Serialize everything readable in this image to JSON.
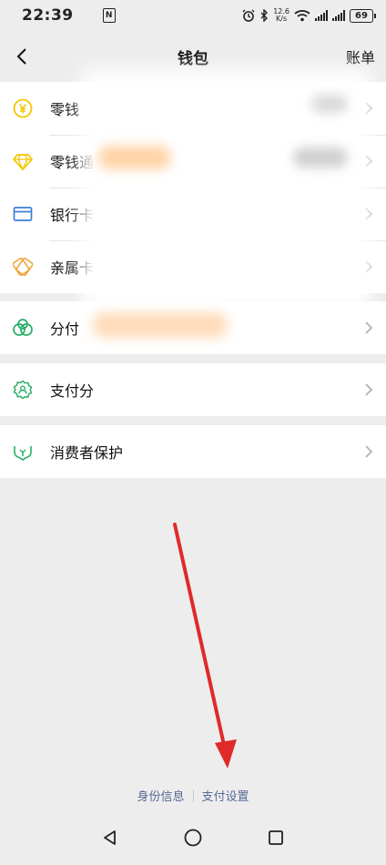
{
  "status_bar": {
    "time": "22:39",
    "nfc": "N",
    "net_speed_value": "12.6",
    "net_speed_unit": "K/s",
    "battery": "69"
  },
  "nav": {
    "title": "钱包",
    "right_link": "账单"
  },
  "groups": [
    {
      "items": [
        {
          "label": "零钱",
          "icon": "yuan-coin-icon",
          "color": "#f2c600"
        },
        {
          "label": "零钱通",
          "icon": "diamond-icon",
          "color": "#f2c600"
        },
        {
          "label": "银行卡",
          "icon": "bank-card-icon",
          "color": "#3d7fd6"
        },
        {
          "label": "亲属卡",
          "icon": "family-card-icon",
          "color": "#f0a43a"
        }
      ]
    },
    {
      "items": [
        {
          "label": "分付",
          "icon": "fenfu-icon",
          "color": "#2aae67"
        }
      ]
    },
    {
      "items": [
        {
          "label": "支付分",
          "icon": "pay-score-icon",
          "color": "#2aae67"
        }
      ]
    },
    {
      "items": [
        {
          "label": "消费者保护",
          "icon": "consumer-protection-icon",
          "color": "#2aae67"
        }
      ]
    }
  ],
  "footer": {
    "identity_link": "身份信息",
    "pay_settings_link": "支付设置",
    "link_color": "#576b95"
  },
  "annotation": {
    "type": "red-arrow",
    "color": "#e02a2a",
    "points_to": "支付设置"
  }
}
